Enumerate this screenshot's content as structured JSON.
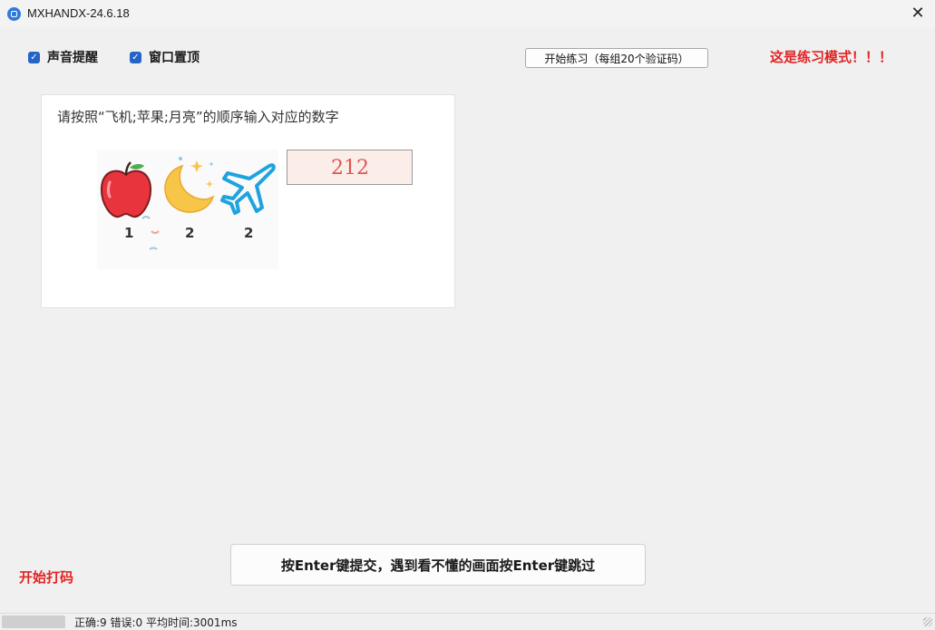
{
  "window": {
    "title": "MXHANDX-24.6.18",
    "close_glyph": "✕"
  },
  "options": {
    "sound_alert_label": "声音提醒",
    "sound_alert_checked": true,
    "pin_top_label": "窗口置顶",
    "pin_top_checked": true
  },
  "toolbar": {
    "start_practice_label": "开始练习（每组20个验证码）",
    "practice_mode_text": "这是练习模式！！！"
  },
  "captcha": {
    "instruction": "请按照“飞机;苹果;月亮”的顺序输入对应的数字",
    "image_numbers": [
      "1",
      "2",
      "2"
    ],
    "image_icons": [
      "apple-icon",
      "moon-icon",
      "airplane-icon"
    ],
    "answer_value": "212"
  },
  "actions": {
    "submit_hint_label": "按Enter键提交，遇到看不懂的画面按Enter键跳过",
    "start_typing_label": "开始打码"
  },
  "status": {
    "text": "正确:9 错误:0 平均时间:3001ms"
  },
  "colors": {
    "accent": "#2563c7",
    "alert_red": "#e02424",
    "input_bg": "#fbeee8"
  }
}
